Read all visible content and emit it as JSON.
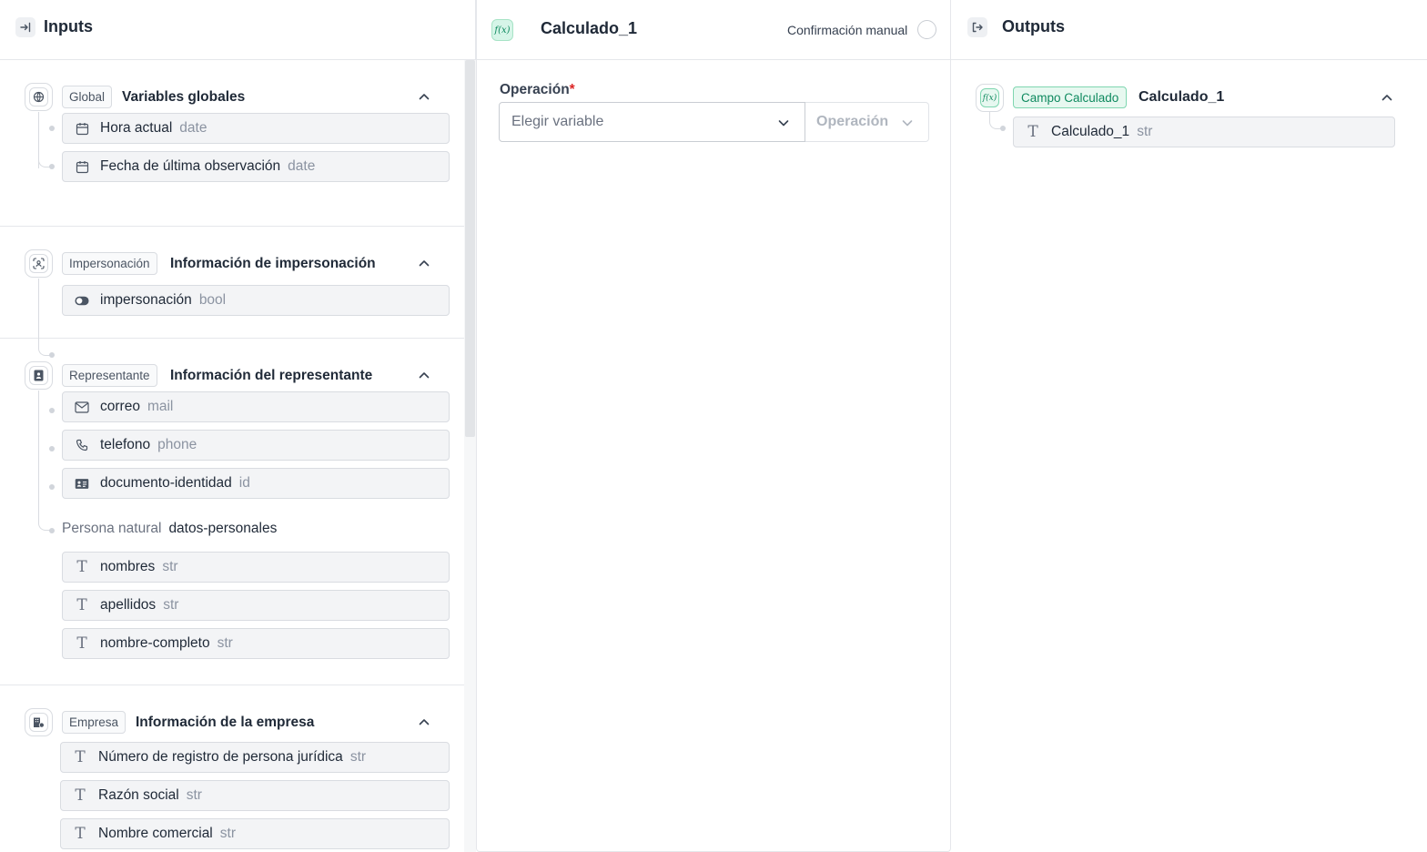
{
  "inputs": {
    "title": "Inputs",
    "sections": [
      {
        "badge": "Global",
        "title": "Variables globales",
        "items": [
          {
            "label": "Hora actual",
            "type": "date"
          },
          {
            "label": "Fecha de última observación",
            "type": "date"
          }
        ]
      },
      {
        "badge": "Impersonación",
        "title": "Información de impersonación",
        "items": [
          {
            "label": "impersonación",
            "type": "bool"
          }
        ]
      },
      {
        "badge": "Representante",
        "title": "Información del representante",
        "items": [
          {
            "label": "correo",
            "type": "mail"
          },
          {
            "label": "telefono",
            "type": "phone"
          },
          {
            "label": "documento-identidad",
            "type": "id"
          }
        ],
        "group": {
          "kind": "Persona natural",
          "name": "datos-personales",
          "items": [
            {
              "label": "nombres",
              "type": "str"
            },
            {
              "label": "apellidos",
              "type": "str"
            },
            {
              "label": "nombre-completo",
              "type": "str"
            }
          ]
        }
      },
      {
        "badge": "Empresa",
        "title": "Información de la empresa",
        "items": [
          {
            "label": "Número de registro de persona jurídica",
            "type": "str"
          },
          {
            "label": "Razón social",
            "type": "str"
          },
          {
            "label": "Nombre comercial",
            "type": "str"
          }
        ]
      }
    ]
  },
  "editor": {
    "icon_text": "f(x)",
    "title": "Calculado_1",
    "manual_label": "Confirmación manual",
    "operation_label": "Operación",
    "required_mark": "*",
    "variable_placeholder": "Elegir variable",
    "operation_placeholder": "Operación"
  },
  "outputs": {
    "title": "Outputs",
    "badge": "Campo Calculado",
    "name": "Calculado_1",
    "icon_text": "f(x)",
    "items": [
      {
        "label": "Calculado_1",
        "type": "str"
      }
    ]
  },
  "colors": {
    "accent_green": "#0f8a5f",
    "required_red": "#dc2626",
    "type_gray": "#8b93a1"
  }
}
